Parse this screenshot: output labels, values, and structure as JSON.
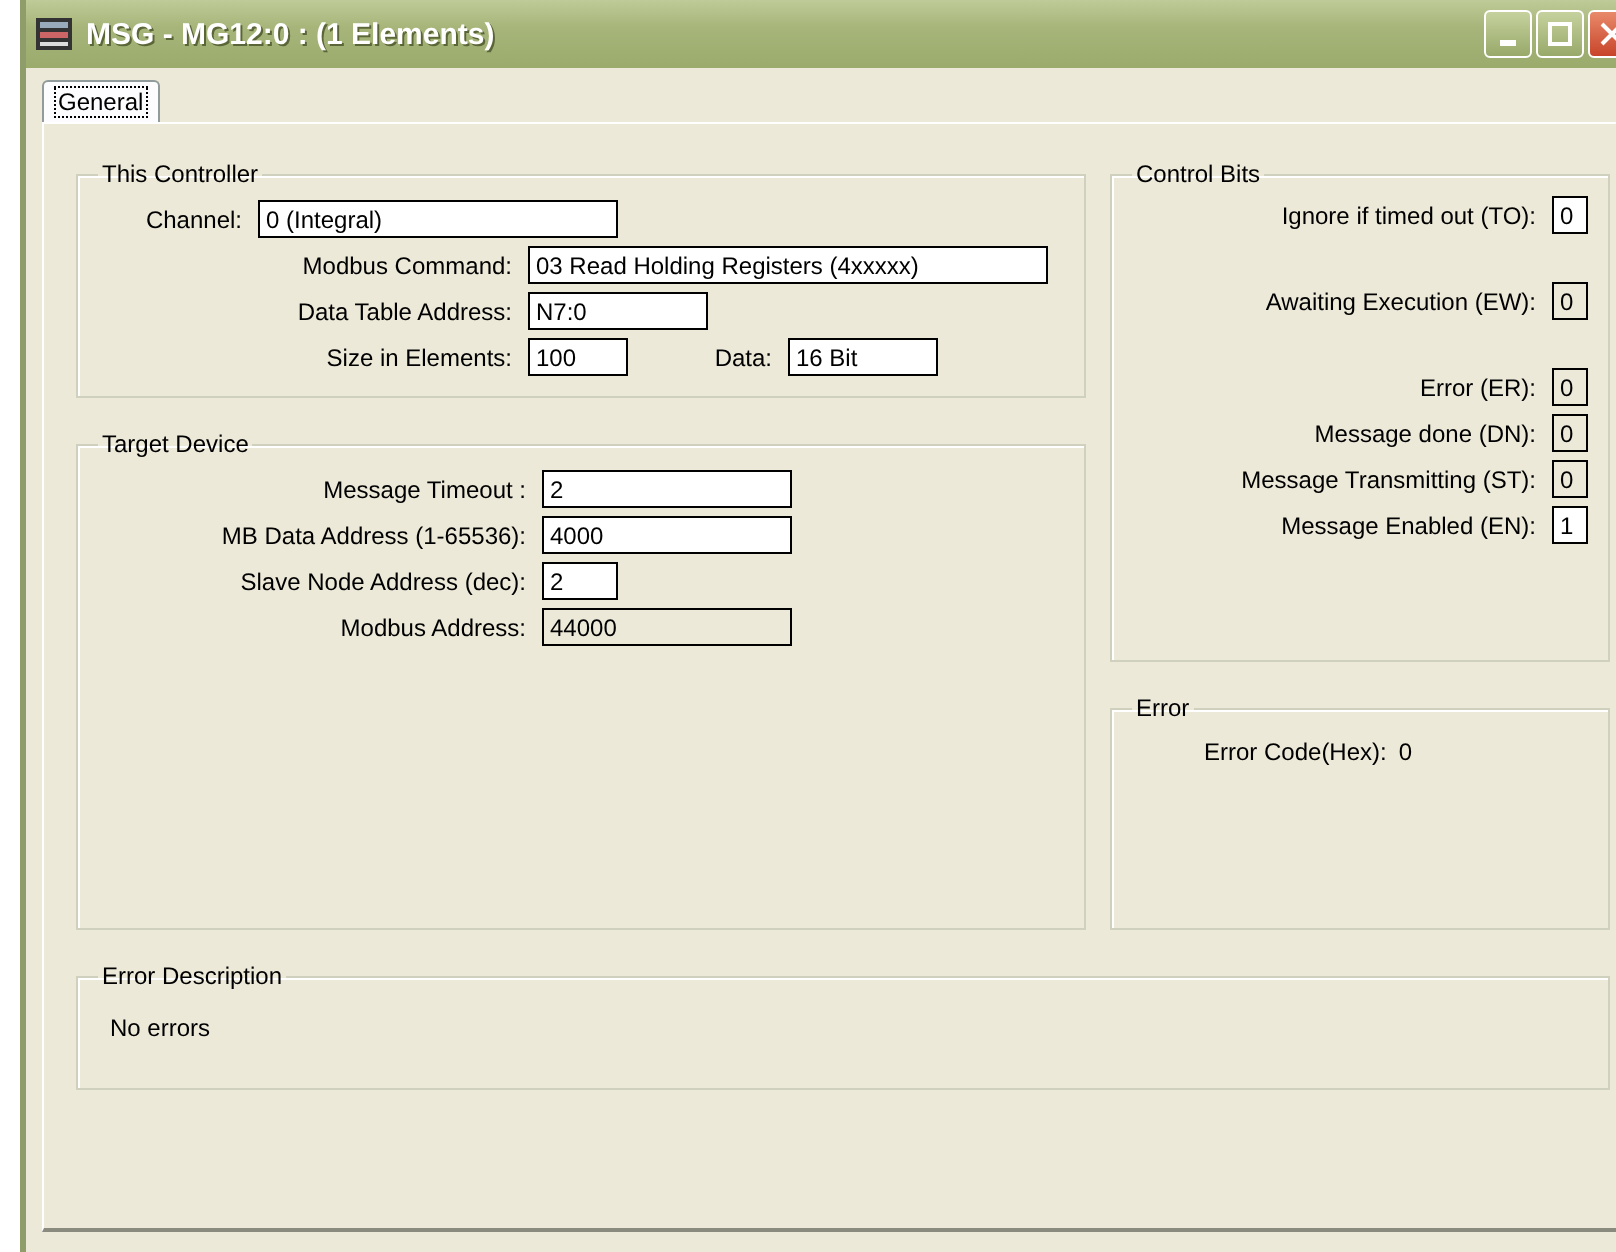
{
  "window": {
    "title": "MSG - MG12:0 : (1 Elements)"
  },
  "tabs": [
    {
      "label": "General",
      "selected": true
    }
  ],
  "controller": {
    "title": "This Controller",
    "rows": [
      {
        "fields": [
          {
            "label": "Channel:",
            "value": "0 (Integral)",
            "disabled": false
          }
        ]
      },
      {
        "fields": [
          {
            "label": "Modbus Command:",
            "value": "03 Read Holding Registers (4xxxxx)",
            "disabled": false
          }
        ]
      },
      {
        "fields": [
          {
            "label": "Data Table Address:",
            "value": "N7:0",
            "disabled": false
          }
        ]
      },
      {
        "fields": [
          {
            "label": "Size in Elements:",
            "value": "100",
            "disabled": false
          },
          {
            "label": "Data:",
            "value": "16 Bit",
            "disabled": false
          }
        ]
      }
    ]
  },
  "target": {
    "title": "Target Device",
    "fields": [
      {
        "label": "Message Timeout :",
        "value": "2",
        "disabled": false
      },
      {
        "label": "MB Data Address (1-65536):",
        "value": "4000",
        "disabled": false
      },
      {
        "label": "Slave Node Address (dec):",
        "value": "2",
        "disabled": false
      },
      {
        "label": "Modbus Address:",
        "value": "44000",
        "disabled": true
      }
    ]
  },
  "control_bits": {
    "title": "Control Bits",
    "bits": [
      {
        "label": "Ignore if timed out (TO):",
        "value": "0",
        "disabled": false
      },
      {
        "label": "Awaiting Execution (EW):",
        "value": "0",
        "disabled": true
      },
      {
        "label": "Error (ER):",
        "value": "0",
        "disabled": true
      },
      {
        "label": "Message done (DN):",
        "value": "0",
        "disabled": true
      },
      {
        "label": "Message Transmitting (ST):",
        "value": "0",
        "disabled": true
      },
      {
        "label": "Message Enabled (EN):",
        "value": "1",
        "disabled": false
      }
    ]
  },
  "error": {
    "title": "Error",
    "label": "Error Code(Hex):",
    "value": "0"
  },
  "error_description": {
    "title": "Error Description",
    "text": "No errors"
  }
}
